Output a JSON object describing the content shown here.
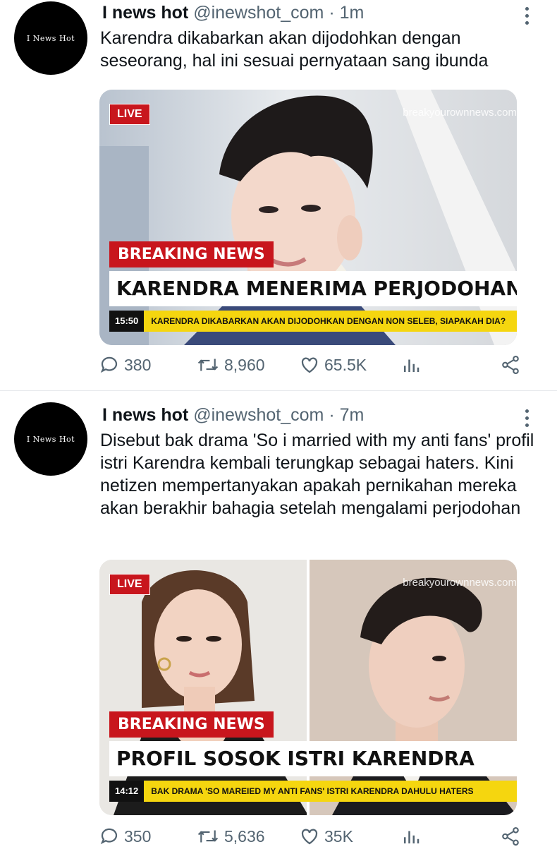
{
  "tweets": [
    {
      "avatar_text": "I News Hot",
      "name": "I news hot",
      "handle": "@inewshot_com",
      "separator": "·",
      "time": "1m",
      "text": "Karendra dikabarkan akan dijodohkan dengan seseorang, hal ini sesuai pernyataan sang ibunda",
      "media": {
        "live": "LIVE",
        "watermark": "breakyourownnews.com",
        "breaking": "BREAKING NEWS",
        "headline": "KARENDRA MENERIMA PERJODOHAN",
        "clock": "15:50",
        "ticker": "KARENDRA DIKABARKAN AKAN DIJODOHKAN DENGAN NON SELEB, SIAPAKAH DIA?"
      },
      "actions": {
        "replies": "380",
        "retweets": "8,960",
        "likes": "65.5K"
      }
    },
    {
      "avatar_text": "I News Hot",
      "name": "I news hot",
      "handle": "@inewshot_com",
      "separator": "·",
      "time": "7m",
      "text": "Disebut bak drama 'So i married with my anti fans' profil istri Karendra kembali terungkap sebagai haters. Kini netizen mempertanyakan apakah pernikahan mereka akan berakhir bahagia setelah mengalami perjodohan",
      "media": {
        "live": "LIVE",
        "watermark": "breakyourownnews.com",
        "breaking": "BREAKING NEWS",
        "headline": "PROFIL SOSOK ISTRI KARENDRA",
        "clock": "14:12",
        "ticker": "BAK DRAMA 'SO MAREIED MY ANTI FANS' ISTRI KARENDRA DAHULU HATERS"
      },
      "actions": {
        "replies": "350",
        "retweets": "5,636",
        "likes": "35K"
      }
    }
  ],
  "icons": [
    "reply-icon",
    "retweet-icon",
    "like-icon",
    "analytics-icon",
    "share-icon",
    "more-icon"
  ],
  "colors": {
    "breaking_red": "#c8161d",
    "ticker_yellow": "#f5d60f",
    "muted": "#536471"
  }
}
